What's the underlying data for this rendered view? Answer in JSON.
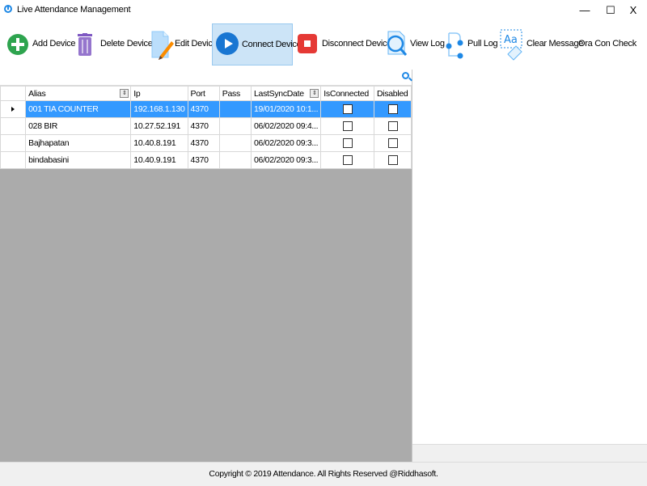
{
  "window": {
    "title": "Live Attendance Management",
    "minimize": "—",
    "maximize": "☐",
    "close": "X"
  },
  "toolbar": {
    "add_device": "Add Device",
    "delete_device": "Delete Device",
    "edit_device": "Edit Device",
    "connect_device": "Connect Device",
    "disconnect_device": "Disconnect Device",
    "view_log": "View Log",
    "pull_log": "Pull Log",
    "clear_message": "Clear Message",
    "ora_con_check": "Ora Con Check"
  },
  "grid": {
    "columns": [
      "Alias",
      "Ip",
      "Port",
      "Pass",
      "LastSyncDate",
      "IsConnected",
      "Disabled"
    ],
    "rows": [
      {
        "alias": "001 TIA COUNTER",
        "ip": "192.168.1.130",
        "port": "4370",
        "pass": "",
        "last_sync": "19/01/2020 10:1...",
        "is_connected": false,
        "disabled": false,
        "selected": true
      },
      {
        "alias": "028 BIR",
        "ip": "10.27.52.191",
        "port": "4370",
        "pass": "",
        "last_sync": "06/02/2020 09:4...",
        "is_connected": false,
        "disabled": false,
        "selected": false
      },
      {
        "alias": "Bajhapatan",
        "ip": "10.40.8.191",
        "port": "4370",
        "pass": "",
        "last_sync": "06/02/2020 09:3...",
        "is_connected": false,
        "disabled": false,
        "selected": false
      },
      {
        "alias": "bindabasini",
        "ip": "10.40.9.191",
        "port": "4370",
        "pass": "",
        "last_sync": "06/02/2020 09:3...",
        "is_connected": false,
        "disabled": false,
        "selected": false
      }
    ]
  },
  "colors": {
    "selection": "#3399ff",
    "active_button": "#cce4f7",
    "grid_background": "#ababab"
  },
  "status": {
    "copyright": "Copyright © 2019 Attendance. All Rights Reserved @Riddhasoft."
  }
}
